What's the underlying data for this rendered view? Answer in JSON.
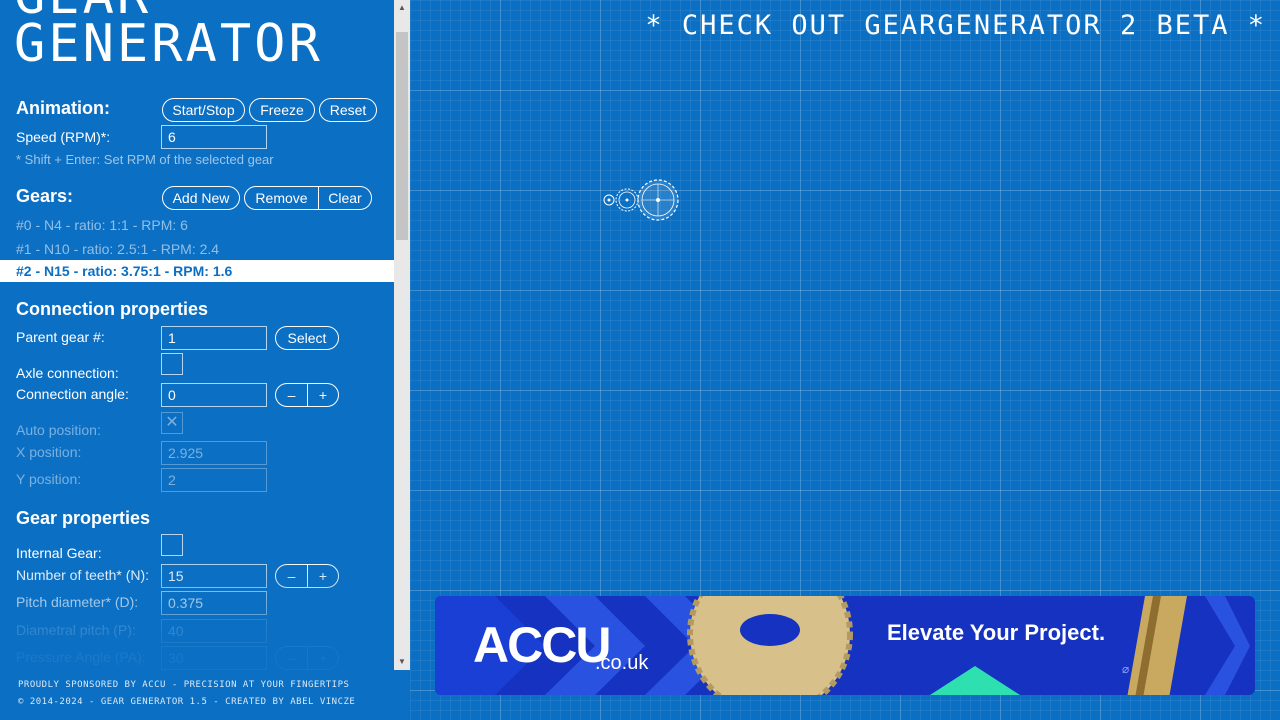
{
  "logo": {
    "line1": "GEAR",
    "line2": "GENERATOR"
  },
  "animation": {
    "title": "Animation:",
    "start_stop": "Start/Stop",
    "freeze": "Freeze",
    "reset": "Reset",
    "speed_label": "Speed (RPM)*:",
    "speed_value": "6",
    "shift_note": "* Shift + Enter: Set RPM of the selected gear"
  },
  "gears": {
    "title": "Gears:",
    "add_new": "Add New",
    "remove": "Remove",
    "clear": "Clear",
    "items": [
      {
        "label": "#0 - N4 - ratio: 1:1 - RPM: 6"
      },
      {
        "label": "#1 - N10 - ratio: 2.5:1 - RPM: 2.4"
      },
      {
        "label": "#2 - N15 - ratio: 3.75:1 - RPM: 1.6"
      }
    ]
  },
  "connection": {
    "title": "Connection properties",
    "parent_label": "Parent gear #:",
    "parent_value": "1",
    "select": "Select",
    "axle_label": "Axle connection:",
    "angle_label": "Connection angle:",
    "angle_value": "0",
    "minus": "–",
    "plus": "+",
    "auto_label": "Auto position:",
    "auto_check": "✕",
    "x_label": "X position:",
    "x_value": "2.925",
    "y_label": "Y position:",
    "y_value": "2"
  },
  "gear_props": {
    "title": "Gear properties",
    "internal_label": "Internal Gear:",
    "teeth_label": "Number of teeth* (N):",
    "teeth_value": "15",
    "minus": "–",
    "plus": "+",
    "pitch_diam_label": "Pitch diameter* (D):",
    "pitch_diam_value": "0.375",
    "diam_pitch_label": "Diametral pitch (P):",
    "diam_pitch_value": "40",
    "pressure_label": "Pressure Angle (PA):",
    "pressure_value": "30"
  },
  "footer": {
    "line1": "PROUDLY SPONSORED BY ACCU - PRECISION AT YOUR FINGERTIPS",
    "line2": "© 2014-2024 - GEAR GENERATOR 1.5 - CREATED BY ABEL VINCZE"
  },
  "canvas": {
    "beta_banner": "* CHECK OUT GEARGENERATOR 2 BETA *"
  },
  "ad": {
    "brand": "ACCU",
    "brand_suffix": ".co.uk",
    "tagline": "Elevate Your Project.",
    "adchoices_icon": "⌀"
  },
  "colors": {
    "background": "#0b6fc4",
    "ad_background": "#1532c0",
    "ad_accent": "#2ee0b0"
  },
  "icons": {
    "scroll_up": "up-arrow-icon",
    "scroll_down": "down-arrow-icon"
  }
}
